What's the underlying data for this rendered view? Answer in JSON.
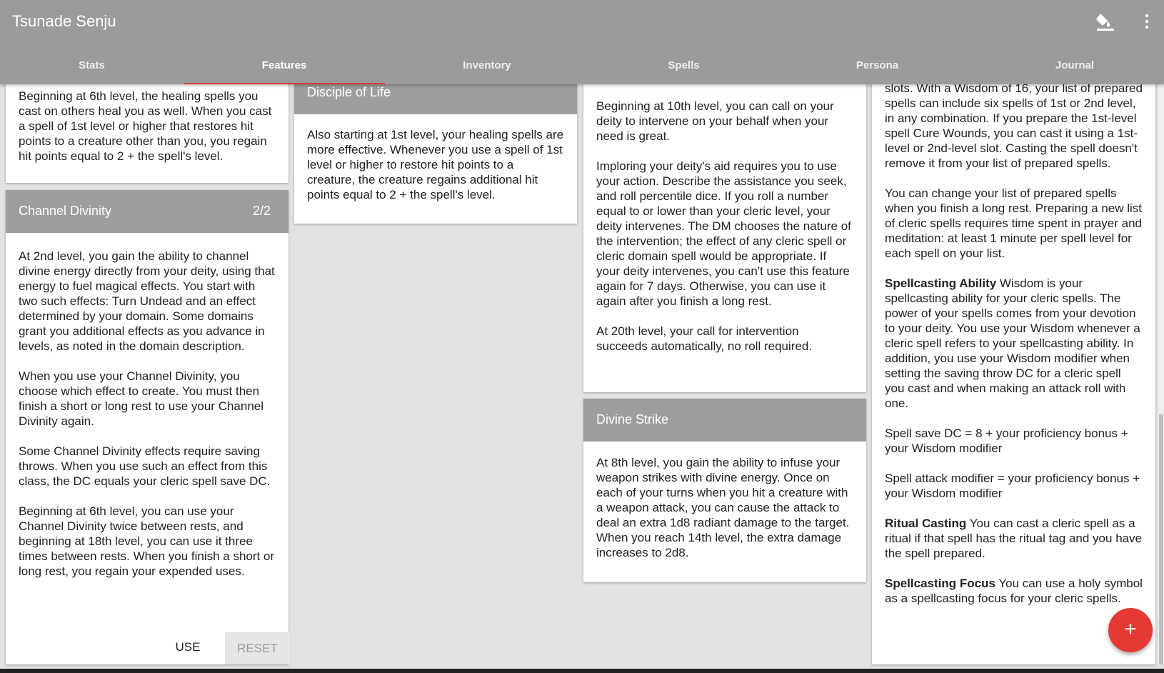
{
  "app": {
    "title": "Tsunade Senju"
  },
  "icons": {
    "paint": "format-paint-icon",
    "more": "more-vert-icon",
    "add": "add-icon"
  },
  "colors": {
    "appbar": "#9b9b9b",
    "accent": "#e53935",
    "card_header": "#9e9e9e"
  },
  "tabs": [
    {
      "label": "Stats"
    },
    {
      "label": "Features"
    },
    {
      "label": "Inventory"
    },
    {
      "label": "Spells"
    },
    {
      "label": "Persona"
    },
    {
      "label": "Journal"
    }
  ],
  "active_tab": "Features",
  "cards": {
    "blessed_healer": {
      "text": "Beginning at 6th level, the healing spells you cast on others heal you as well. When you cast a spell of 1st level or higher that restores hit points to a creature other than you, you regain hit points equal to 2 + the spell's level."
    },
    "channel_divinity": {
      "title": "Channel Divinity",
      "uses": "2/2",
      "paragraphs": [
        "At 2nd level, you gain the ability to channel divine energy directly from your deity, using that energy to fuel magical effects. You start with two such effects: Turn Undead and an effect determined by your domain. Some domains grant you additional effects as you advance in levels, as noted in the domain description.",
        "When you use your Channel Divinity, you choose which effect to create. You must then finish a short or long rest to use your Channel Divinity again.",
        "Some Channel Divinity effects require saving throws. When you use such an effect from this class, the DC equals your cleric spell save DC.",
        "Beginning at 6th level, you can use your Channel Divinity twice between rests, and beginning at 18th level, you can use it three times between rests. When you finish a short or long rest, you regain your expended uses."
      ],
      "use_label": "USE",
      "reset_label": "RESET"
    },
    "disciple_of_life": {
      "title": "Disciple of Life",
      "text": "Also starting at 1st level, your healing spells are more effective. Whenever you use a spell of 1st level or higher to restore hit points to a creature, the creature regains additional hit points equal to 2 + the spell's level."
    },
    "divine_intervention": {
      "paragraphs": [
        "Beginning at 10th level, you can call on your deity to intervene on your behalf when your need is great.",
        "Imploring your deity's aid requires you to use your action. Describe the assistance you seek, and roll percentile dice. If you roll a number equal to or lower than your cleric level, your deity intervenes. The DM chooses the nature of the intervention; the effect of any cleric spell or cleric domain spell would be appropriate. If your deity intervenes, you can't use this feature again for 7 days. Otherwise, you can use it again after you finish a long rest.",
        "At 20th level, your call for intervention succeeds automatically, no roll required."
      ]
    },
    "divine_strike": {
      "title": "Divine Strike",
      "text": "At 8th level, you gain the ability to infuse your weapon strikes with divine energy. Once on each of your turns when you hit a creature with a weapon attack, you can cause the attack to deal an extra 1d8 radiant damage to the target. When you reach 14th level, the extra damage increases to 2d8."
    },
    "spellcasting": {
      "p1": "slots. With a Wisdom of 16, your list of prepared spells can include six spells of 1st or 2nd level, in any combination. If you prepare the 1st-level spell Cure Wounds, you can cast it using a 1st-level or 2nd-level slot. Casting the spell doesn't remove it from your list of prepared spells.",
      "p2": "You can change your list of prepared spells when you finish a long rest. Preparing a new list of cleric spells requires time spent in prayer and meditation: at least 1 minute per spell level for each spell on your list.",
      "ability_label": "Spellcasting Ability",
      "ability_text": " Wisdom is your spellcasting ability for your cleric spells. The power of your spells comes from your devotion to your deity. You use your Wisdom whenever a cleric spell refers to your spellcasting ability. In addition, you use your Wisdom modifier when setting the saving throw DC for a cleric spell you cast and when making an attack roll with one.",
      "save_dc": "Spell save DC = 8 + your proficiency bonus + your Wisdom modifier",
      "attack_mod": "Spell attack modifier = your proficiency bonus + your Wisdom modifier",
      "ritual_label": "Ritual Casting",
      "ritual_text": " You can cast a cleric spell as a ritual if that spell has the ritual tag and you have the spell prepared.",
      "focus_label": "Spellcasting Focus",
      "focus_text": " You can use a holy symbol as a spellcasting focus for your cleric spells."
    }
  },
  "fab": {
    "label": "+"
  }
}
